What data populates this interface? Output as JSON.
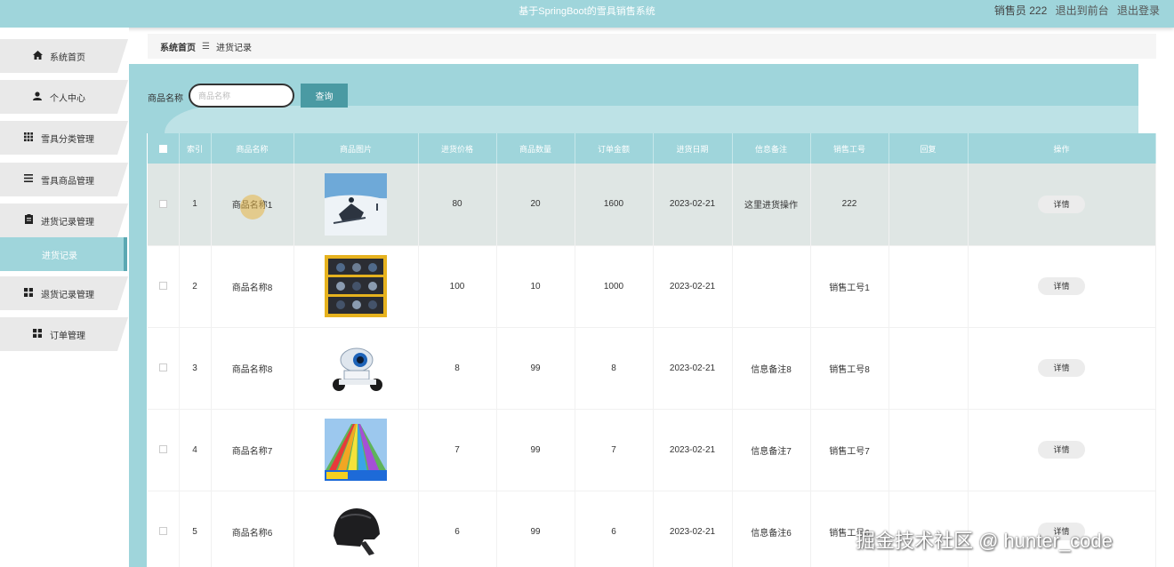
{
  "app": {
    "title": "基于SpringBoot的雪具销售系统",
    "user_label": "销售员 222",
    "back_front_label": "退出到前台",
    "logout_label": "退出登录"
  },
  "sidebar": {
    "items": [
      {
        "label": "系统首页",
        "icon": "home-icon"
      },
      {
        "label": "个人中心",
        "icon": "user-icon"
      },
      {
        "label": "雪具分类管理",
        "icon": "grid-icon"
      },
      {
        "label": "雪具商品管理",
        "icon": "list-icon"
      },
      {
        "label": "进货记录管理",
        "icon": "clipboard-icon"
      },
      {
        "label": "退货记录管理",
        "icon": "apps-icon"
      },
      {
        "label": "订单管理",
        "icon": "apps-icon"
      }
    ],
    "active_sub_label": "进货记录"
  },
  "breadcrumb": {
    "home": "系统首页",
    "separator": "☰",
    "current": "进货记录"
  },
  "search": {
    "label": "商品名称",
    "placeholder": "商品名称",
    "button_label": "查询"
  },
  "table": {
    "columns": [
      "索引",
      "商品名称",
      "商品图片",
      "进货价格",
      "商品数量",
      "订单金额",
      "进货日期",
      "信息备注",
      "销售工号",
      "回复",
      "操作"
    ],
    "detail_label": "详情",
    "rows": [
      {
        "index": "1",
        "name": "商品名称1",
        "image": "snowmobile-photo",
        "price": "80",
        "qty": "20",
        "amount": "1600",
        "date": "2023-02-21",
        "remark": "这里进货操作",
        "staff": "222",
        "reply": ""
      },
      {
        "index": "2",
        "name": "商品名称8",
        "image": "ski-boots-rack-photo",
        "price": "100",
        "qty": "10",
        "amount": "1000",
        "date": "2023-02-21",
        "remark": "",
        "staff": "销售工号1",
        "reply": ""
      },
      {
        "index": "3",
        "name": "商品名称8",
        "image": "camera-robot-photo",
        "price": "8",
        "qty": "99",
        "amount": "8",
        "date": "2023-02-21",
        "remark": "信息备注8",
        "staff": "销售工号8",
        "reply": ""
      },
      {
        "index": "4",
        "name": "商品名称7",
        "image": "rainbow-slide-photo",
        "price": "7",
        "qty": "99",
        "amount": "7",
        "date": "2023-02-21",
        "remark": "信息备注7",
        "staff": "销售工号7",
        "reply": ""
      },
      {
        "index": "5",
        "name": "商品名称6",
        "image": "helmet-photo",
        "price": "6",
        "qty": "99",
        "amount": "6",
        "date": "2023-02-21",
        "remark": "信息备注6",
        "staff": "销售工号6",
        "reply": ""
      }
    ]
  },
  "watermark": "掘金技术社区 @ hunter_code",
  "colors": {
    "accent": "#9fd5db",
    "accent_dark": "#4a9aa3",
    "menu_bg": "#e9e9e9",
    "selected_row": "#dfe6e4"
  }
}
